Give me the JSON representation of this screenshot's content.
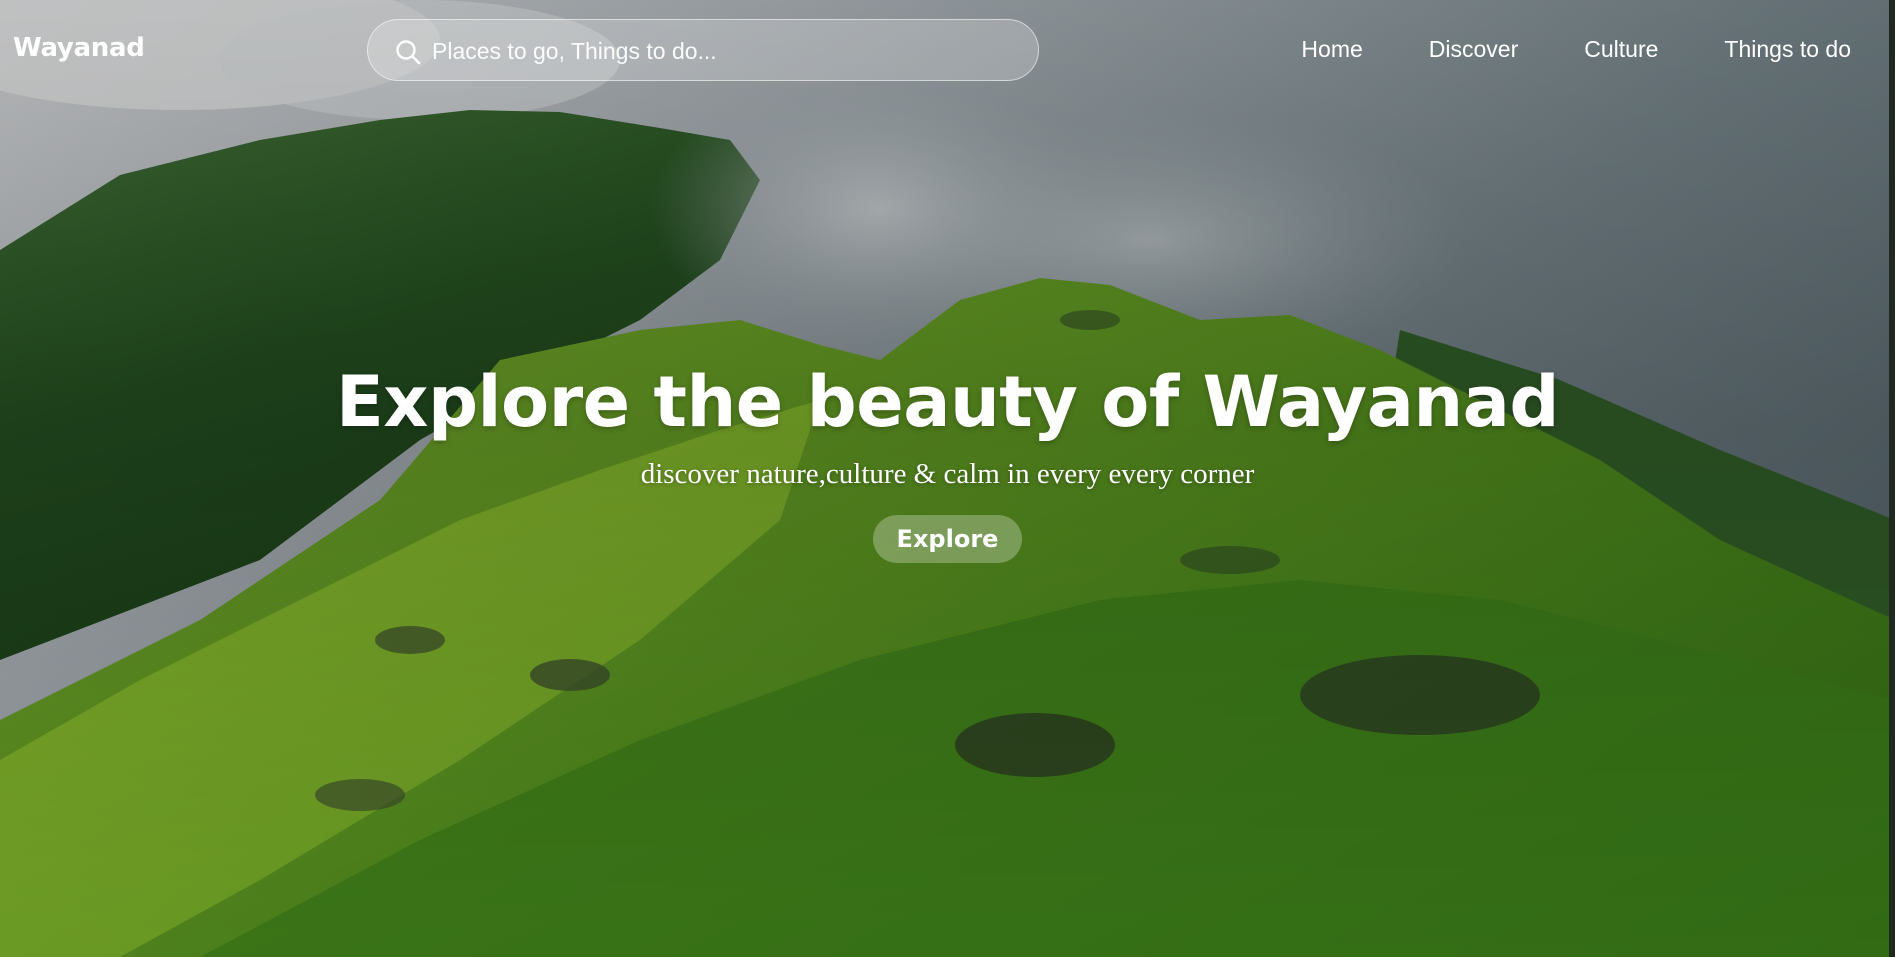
{
  "brand": {
    "name": "Wayanad"
  },
  "search": {
    "placeholder": "Places to go, Things to do...",
    "value": "",
    "icon": "search-icon"
  },
  "nav": {
    "items": [
      {
        "label": "Home"
      },
      {
        "label": "Discover"
      },
      {
        "label": "Culture"
      },
      {
        "label": "Things to do"
      }
    ]
  },
  "hero": {
    "title": "Explore the beauty of Wayanad",
    "subtitle": "discover nature,culture & calm in every every corner",
    "button_label": "Explore"
  },
  "colors": {
    "text": "#ffffff",
    "sky": "#8a9298",
    "grass_light": "#8fbf2e",
    "grass_dark": "#2f6a14",
    "forest": "#1f4a1e"
  }
}
